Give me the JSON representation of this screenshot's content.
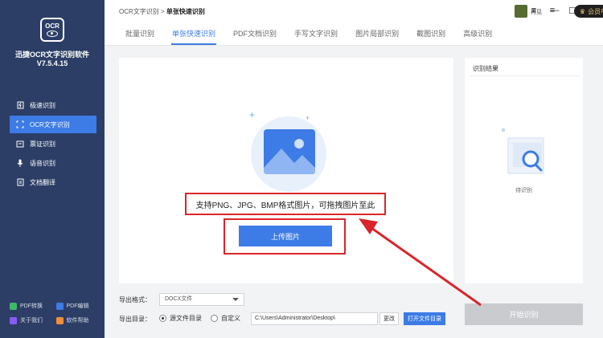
{
  "sidebar": {
    "app_name": "迅捷OCR文字识别软件",
    "version": "V7.5.4.15",
    "nav": [
      {
        "label": "极速识别",
        "icon": "lightning-icon"
      },
      {
        "label": "OCR文字识别",
        "icon": "ocr-icon"
      },
      {
        "label": "票证识别",
        "icon": "ticket-icon"
      },
      {
        "label": "语音识别",
        "icon": "microphone-icon"
      },
      {
        "label": "文档翻译",
        "icon": "translate-icon"
      }
    ],
    "links": [
      {
        "label": "PDF转换",
        "color": "#3fb868"
      },
      {
        "label": "PDF编辑",
        "color": "#3d7be6"
      },
      {
        "label": "关于我们",
        "color": "#8a5cf5"
      },
      {
        "label": "软件帮助",
        "color": "#f0913a"
      }
    ]
  },
  "titlebar": {
    "crumb_root": "OCR文字识别",
    "crumb_sep": ">",
    "crumb_current": "单张快速识别",
    "zaijian": "再见",
    "vip": "会员中心"
  },
  "tabs": [
    {
      "label": "批量识别",
      "active": false
    },
    {
      "label": "单张快速识别",
      "active": true
    },
    {
      "label": "PDF文档识别",
      "active": false
    },
    {
      "label": "手写文字识别",
      "active": false
    },
    {
      "label": "图片局部识别",
      "active": false
    },
    {
      "label": "截图识别",
      "active": false
    },
    {
      "label": "高级识别",
      "active": false
    }
  ],
  "upload": {
    "support_text": "支持PNG、JPG、BMP格式图片，可拖拽图片至此",
    "button": "上传图片"
  },
  "result": {
    "title": "识别结果",
    "waiting": "待识别"
  },
  "bottom": {
    "export_format_label": "导出格式：",
    "export_format_value": "DOCX文件",
    "export_dir_label": "导出目录：",
    "radio_source": "源文件目录",
    "radio_custom": "自定义",
    "path_value": "C:\\Users\\Administrator\\Desktop\\",
    "change_button": "更改",
    "open_button": "打开文件目录",
    "start_button": "开始识别"
  },
  "colors": {
    "sidebar_bg": "#2c3e66",
    "accent": "#3d7be6",
    "highlight_red": "#d9252b"
  }
}
